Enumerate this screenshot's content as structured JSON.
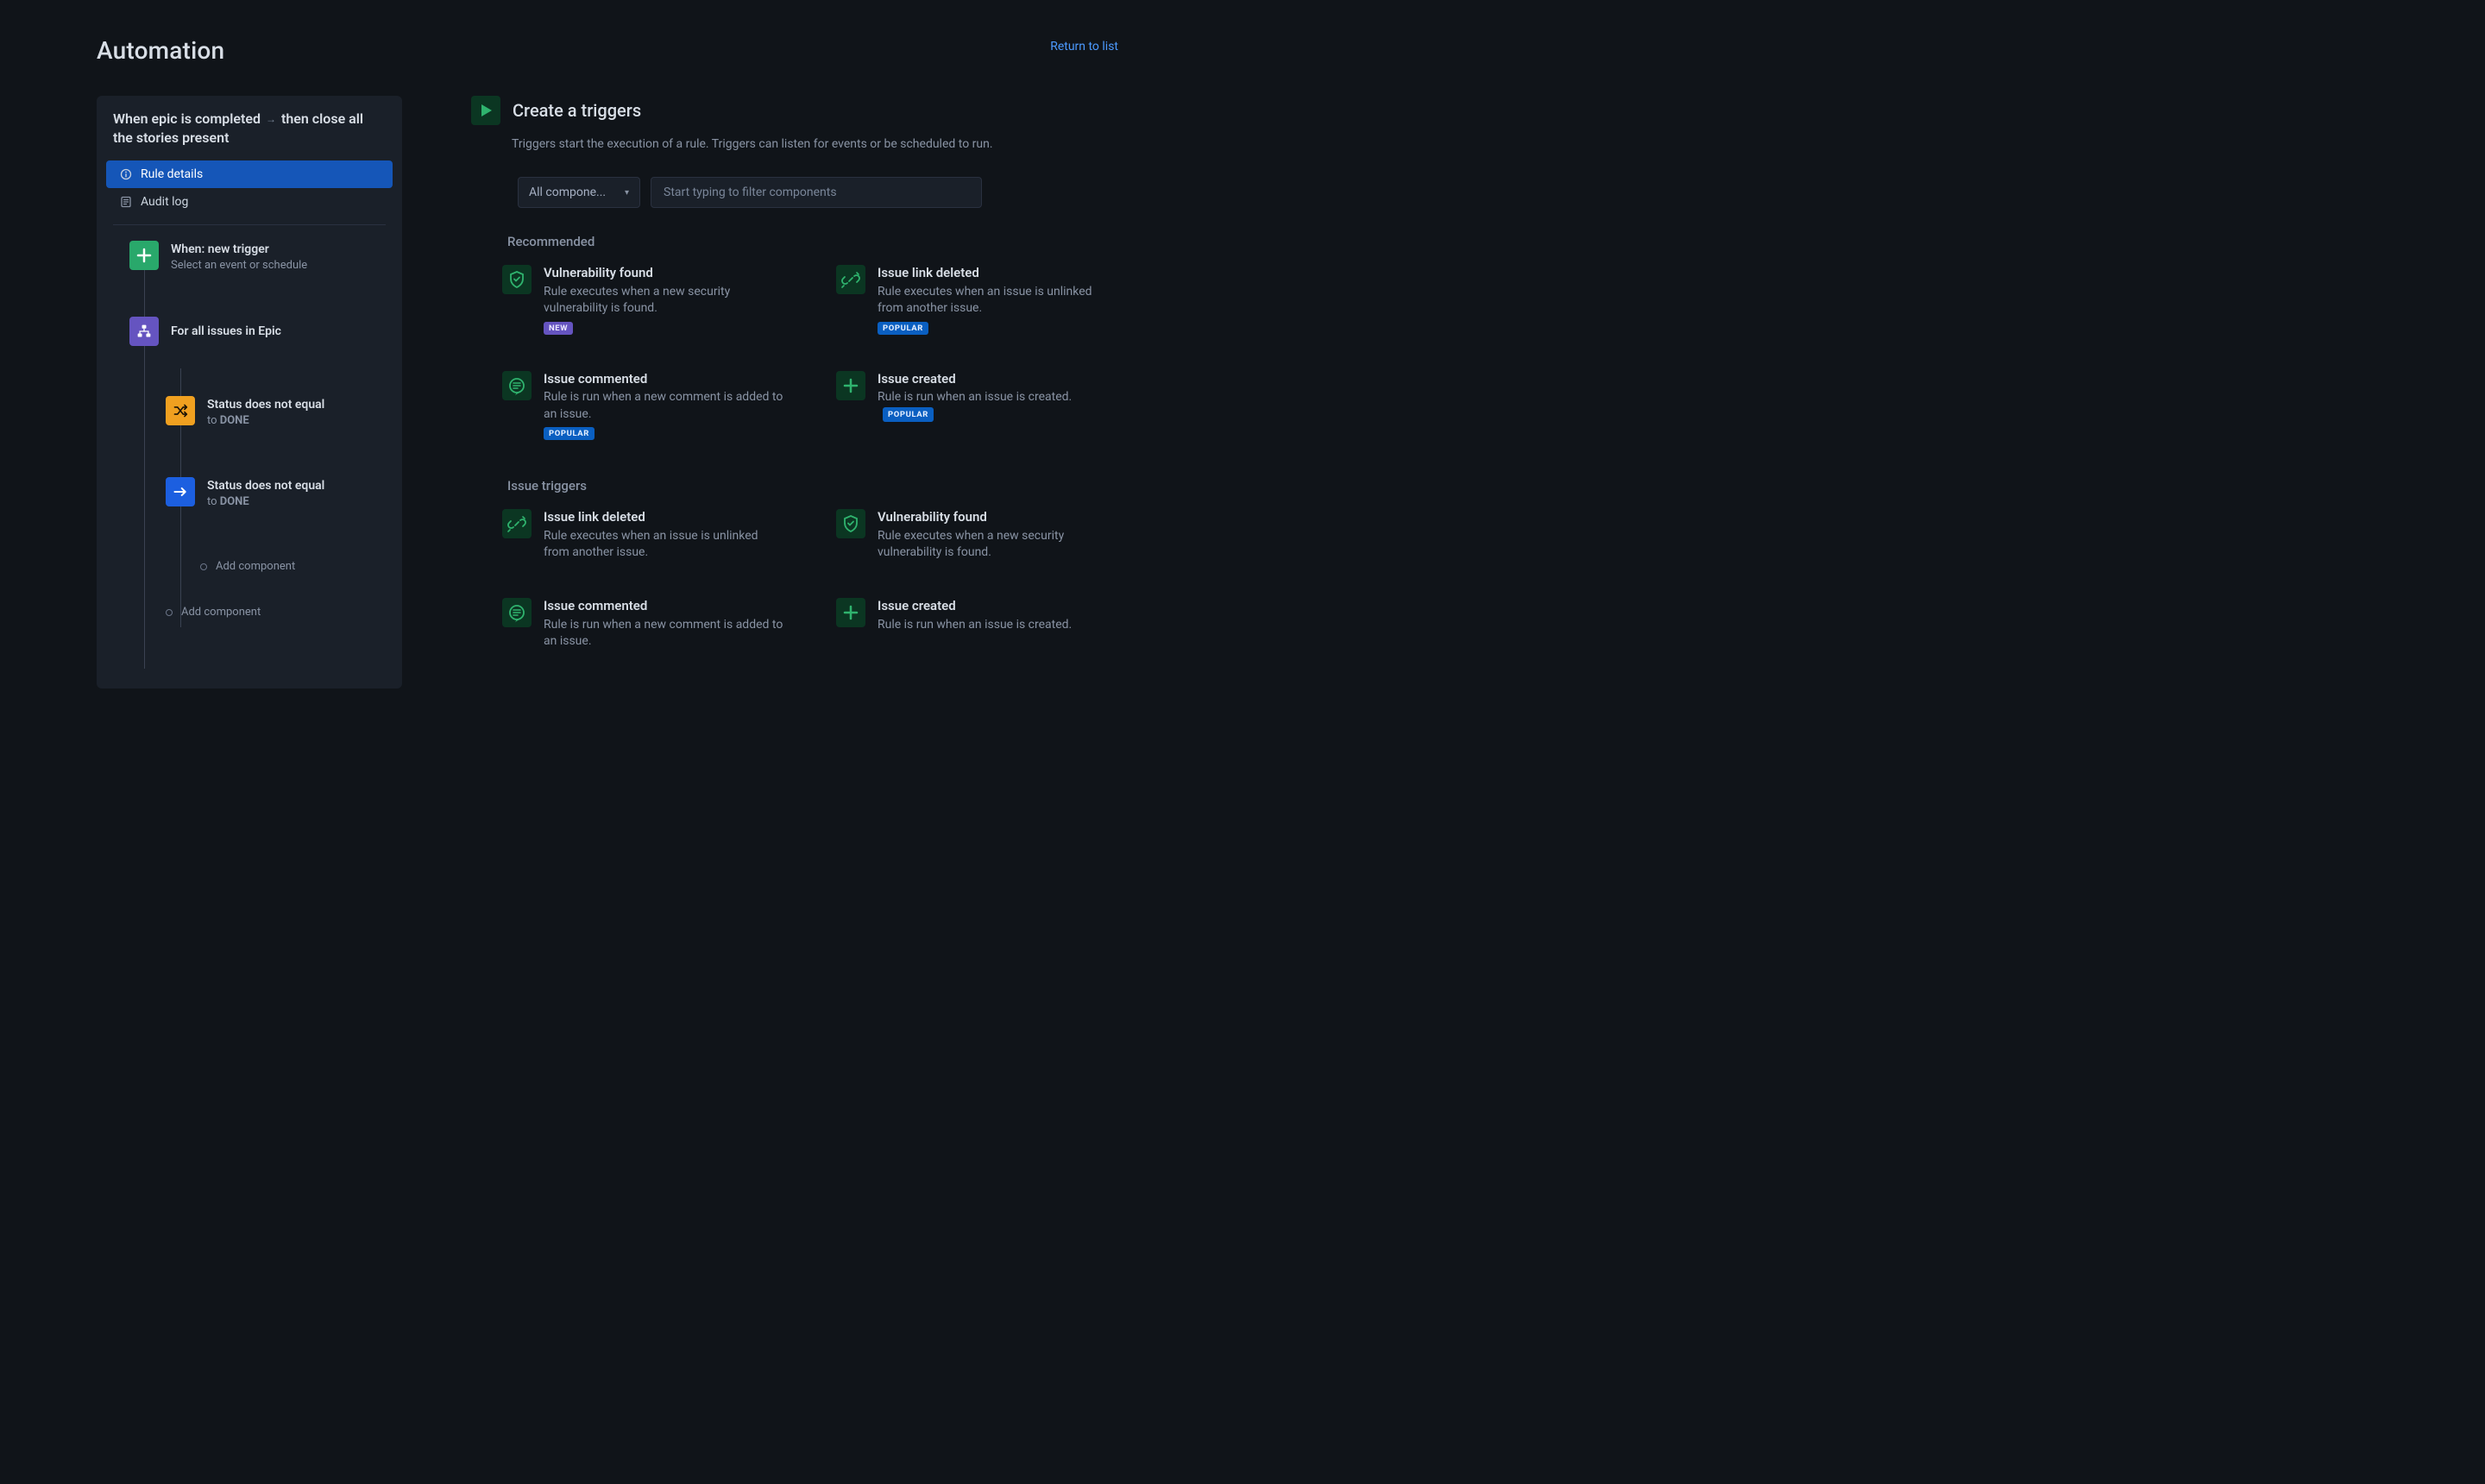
{
  "header": {
    "title": "Automation",
    "return_link": "Return to list"
  },
  "sidebar": {
    "rule_name_prefix": "When epic is completed",
    "rule_name_suffix": "then close all the stories present",
    "nav": [
      {
        "label": "Rule details",
        "active": true
      },
      {
        "label": "Audit log",
        "active": false
      }
    ],
    "flow": {
      "trigger_title": "When: new trigger",
      "trigger_sub": "Select an event or schedule",
      "branch_title": "For all issues in Epic",
      "cond1_title": "Status does not equal",
      "cond1_sub_prefix": "to ",
      "cond1_sub_strong": "DONE",
      "cond2_title": "Status does not equal",
      "cond2_sub_prefix": "to ",
      "cond2_sub_strong": "DONE",
      "add_component_inner": "Add component",
      "add_component_outer": "Add component"
    }
  },
  "main": {
    "title": "Create a triggers",
    "desc": "Triggers start the execution of a rule. Triggers can listen for events or be scheduled to run.",
    "filter_label": "All compone...",
    "search_placeholder": "Start typing to filter components",
    "sections": {
      "recommended_title": "Recommended",
      "issuetriggers_title": "Issue triggers"
    },
    "recommended": [
      {
        "title": "Vulnerability found",
        "desc": "Rule executes when a new security vulnerability is found.",
        "badge": "NEW",
        "badge_style": "purple",
        "icon": "shield"
      },
      {
        "title": "Issue link deleted",
        "desc": "Rule executes when an issue is unlinked from another issue.",
        "badge": "POPULAR",
        "badge_style": "blue",
        "icon": "unlink"
      },
      {
        "title": "Issue commented",
        "desc": "Rule is run when a new comment is added to an issue.",
        "badge": "POPULAR",
        "badge_style": "blue",
        "icon": "comment"
      },
      {
        "title": "Issue created",
        "desc": "Rule is run when an issue is created.",
        "badge": "POPULAR",
        "badge_style": "blue",
        "badge_inline": true,
        "icon": "plus"
      }
    ],
    "issuetriggers": [
      {
        "title": "Issue link deleted",
        "desc": "Rule executes when an issue is unlinked from another issue.",
        "icon": "unlink"
      },
      {
        "title": "Vulnerability found",
        "desc": "Rule executes when a new security vulnerability is found.",
        "icon": "shield"
      },
      {
        "title": "Issue commented",
        "desc": "Rule is run when a new comment is added to an issue.",
        "icon": "comment"
      },
      {
        "title": "Issue created",
        "desc": "Rule is run when an issue is created.",
        "icon": "plus"
      }
    ]
  }
}
